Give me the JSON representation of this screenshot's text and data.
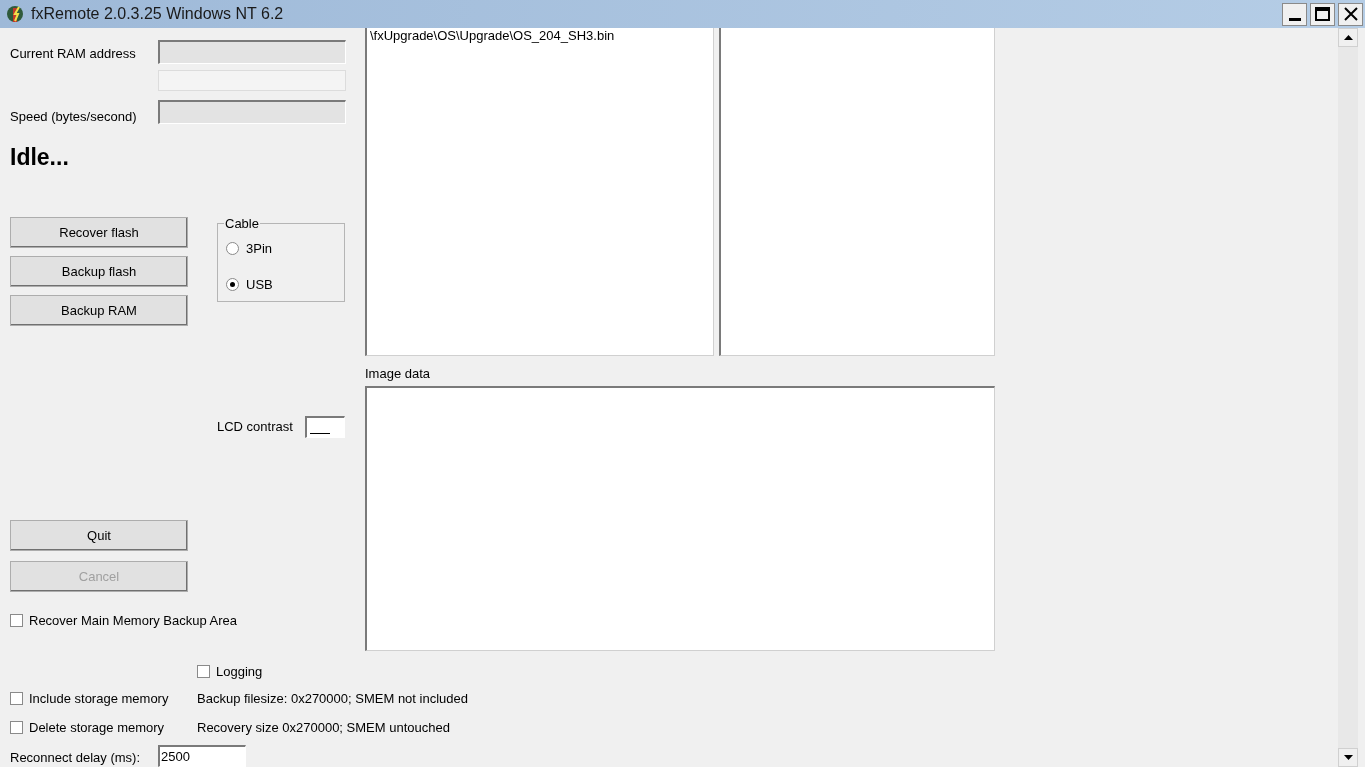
{
  "window": {
    "title": "fxRemote 2.0.3.25 Windows NT 6.2"
  },
  "fields": [
    {
      "label": "Current RAM address"
    },
    {
      "label": "Speed (bytes/second)"
    }
  ],
  "status": "Idle...",
  "buttons": [
    {
      "label": "Recover flash",
      "disabled": false
    },
    {
      "label": "Backup flash",
      "disabled": false
    },
    {
      "label": "Backup RAM",
      "disabled": false
    }
  ],
  "cable": {
    "title": "Cable",
    "options": [
      {
        "label": "3Pin",
        "selected": false
      },
      {
        "label": "USB",
        "selected": true
      }
    ]
  },
  "lcd_contrast": {
    "label": "LCD contrast"
  },
  "action_buttons": [
    {
      "label": "Quit",
      "disabled": false
    },
    {
      "label": "Cancel",
      "disabled": true
    }
  ],
  "recover_main_memory": {
    "label": "Recover Main Memory Backup Area",
    "checked": false
  },
  "file_list": {
    "items": [
      "\\fxUpgrade\\OS\\Upgrade\\OS_204_SH3.bin"
    ]
  },
  "image_data": {
    "label": "Image data"
  },
  "logging": {
    "label": "Logging",
    "checked": false
  },
  "include_storage": {
    "label": "Include storage memory",
    "checked": false
  },
  "delete_storage": {
    "label": "Delete storage memory",
    "checked": false
  },
  "backup_info": "Backup filesize: 0x270000; SMEM not included",
  "recovery_info": "Recovery size 0x270000; SMEM untouched",
  "reconnect_delay": {
    "label": "Reconnect delay (ms):",
    "value": "2500"
  }
}
